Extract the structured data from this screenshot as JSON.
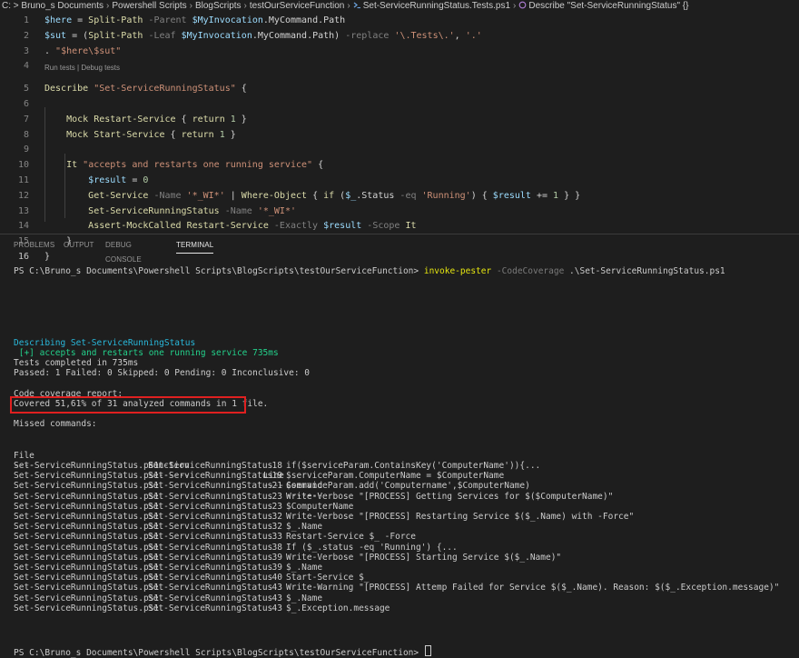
{
  "breadcrumb": {
    "items": [
      "C: > Bruno_s Documents",
      "Powershell Scripts",
      "BlogScripts",
      "testOurServiceFunction"
    ],
    "file": "Set-ServiceRunningStatus.Tests.ps1",
    "symbol": "Describe \"Set-ServiceRunningStatus\" {}"
  },
  "codelens": "Run tests | Debug tests",
  "code_lines": [
    {
      "n": "1",
      "t": "    $here = Split-Path -Parent $MyInvocation.MyCommand.Path"
    },
    {
      "n": "2",
      "t": "    $sut = (Split-Path -Leaf $MyInvocation.MyCommand.Path) -replace '\\.Tests\\.', '.'"
    },
    {
      "n": "3",
      "t": "    . \"$here\\$sut\""
    },
    {
      "n": "4",
      "t": ""
    },
    {
      "n": "5",
      "t": "    Describe \"Set-ServiceRunningStatus\" {"
    },
    {
      "n": "6",
      "t": ""
    },
    {
      "n": "7",
      "t": "        Mock Restart-Service { return 1 }"
    },
    {
      "n": "8",
      "t": "        Mock Start-Service { return 1 }"
    },
    {
      "n": "9",
      "t": ""
    },
    {
      "n": "10",
      "t": "        It \"accepts and restarts one running service\" {"
    },
    {
      "n": "11",
      "t": "            $result = 0"
    },
    {
      "n": "12",
      "t": "            Get-Service -Name '*_WI*' | Where-Object { if ($_.Status -eq 'Running') { $result += 1 } }"
    },
    {
      "n": "13",
      "t": "            Set-ServiceRunningStatus -Name '*_WI*'"
    },
    {
      "n": "14",
      "t": "            Assert-MockCalled Restart-Service -Exactly $result -Scope It"
    },
    {
      "n": "15",
      "t": "        }"
    },
    {
      "n": "16",
      "t": "    }"
    }
  ],
  "panel_tabs": [
    "PROBLEMS",
    "OUTPUT",
    "DEBUG CONSOLE",
    "TERMINAL"
  ],
  "terminal": {
    "prompt": "PS C:\\Bruno_s Documents\\Powershell Scripts\\BlogScripts\\testOurServiceFunction>",
    "command": "invoke-pester",
    "param": "-CodeCoverage",
    "arg": ".\\Set-ServiceRunningStatus.ps1",
    "describing": "Describing Set-ServiceRunningStatus",
    "passed_test": " [+] accepts and restarts one running service 735ms",
    "tests_completed": "Tests completed in 735ms",
    "summary": "Passed: 1 Failed: 0 Skipped: 0 Pending: 0 Inconclusive: 0",
    "coverage_header": "Code coverage report:",
    "coverage_line": "Covered 51,61% of 31 analyzed commands in 1 file.",
    "missed_header": "Missed commands:",
    "table_headers": {
      "file": "File",
      "function": "Function",
      "line": "Line",
      "command": "Command"
    },
    "table_dashes": {
      "file": "----",
      "function": "--------",
      "line": "----",
      "command": "-------"
    },
    "rows": [
      {
        "file": "Set-ServiceRunningStatus.ps1",
        "function": "Set-ServiceRunningStatus",
        "line": "18",
        "command": "if($serviceParam.ContainsKey('ComputerName')){..."
      },
      {
        "file": "Set-ServiceRunningStatus.ps1",
        "function": "Set-ServiceRunningStatus",
        "line": "19",
        "command": "$serviceParam.ComputerName = $ComputerName"
      },
      {
        "file": "Set-ServiceRunningStatus.ps1",
        "function": "Set-ServiceRunningStatus",
        "line": "21",
        "command": "$serviceParam.add('Computername',$ComputerName)"
      },
      {
        "file": "Set-ServiceRunningStatus.ps1",
        "function": "Set-ServiceRunningStatus",
        "line": "23",
        "command": "Write-Verbose \"[PROCESS] Getting Services for $($ComputerName)\""
      },
      {
        "file": "Set-ServiceRunningStatus.ps1",
        "function": "Set-ServiceRunningStatus",
        "line": "23",
        "command": "$ComputerName"
      },
      {
        "file": "Set-ServiceRunningStatus.ps1",
        "function": "Set-ServiceRunningStatus",
        "line": "32",
        "command": "Write-Verbose \"[PROCESS] Restarting Service $($_.Name) with -Force\""
      },
      {
        "file": "Set-ServiceRunningStatus.ps1",
        "function": "Set-ServiceRunningStatus",
        "line": "32",
        "command": "$_.Name"
      },
      {
        "file": "Set-ServiceRunningStatus.ps1",
        "function": "Set-ServiceRunningStatus",
        "line": "33",
        "command": "Restart-Service $_ -Force"
      },
      {
        "file": "Set-ServiceRunningStatus.ps1",
        "function": "Set-ServiceRunningStatus",
        "line": "38",
        "command": "If ($_.status -eq 'Running') {..."
      },
      {
        "file": "Set-ServiceRunningStatus.ps1",
        "function": "Set-ServiceRunningStatus",
        "line": "39",
        "command": "Write-Verbose \"[PROCESS] Starting Service $($_.Name)\""
      },
      {
        "file": "Set-ServiceRunningStatus.ps1",
        "function": "Set-ServiceRunningStatus",
        "line": "39",
        "command": "$_.Name"
      },
      {
        "file": "Set-ServiceRunningStatus.ps1",
        "function": "Set-ServiceRunningStatus",
        "line": "40",
        "command": "Start-Service $_"
      },
      {
        "file": "Set-ServiceRunningStatus.ps1",
        "function": "Set-ServiceRunningStatus",
        "line": "43",
        "command": "Write-Warning \"[PROCESS] Attemp Failed for Service $($_.Name). Reason: $($_.Exception.message)\""
      },
      {
        "file": "Set-ServiceRunningStatus.ps1",
        "function": "Set-ServiceRunningStatus",
        "line": "43",
        "command": "$_.Name"
      },
      {
        "file": "Set-ServiceRunningStatus.ps1",
        "function": "Set-ServiceRunningStatus",
        "line": "43",
        "command": "$_.Exception.message"
      }
    ],
    "final_prompt": "PS C:\\Bruno_s Documents\\Powershell Scripts\\BlogScripts\\testOurServiceFunction>"
  },
  "colors": {
    "background": "#1e1e1e",
    "highlight_box": "#e02020",
    "test_pass": "#23d18b",
    "describing": "#29b8db"
  }
}
